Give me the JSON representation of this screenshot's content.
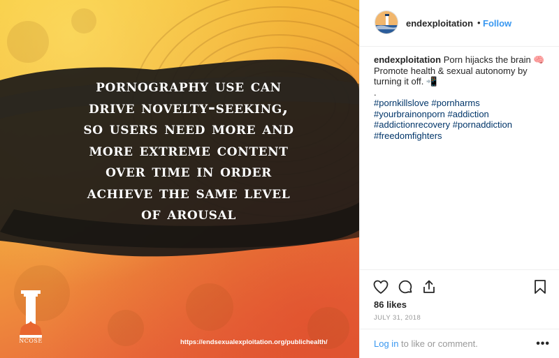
{
  "post": {
    "image": {
      "headline_lines": [
        "Pornography use can",
        "drive novelty-seeking,",
        "so users need more and",
        "more extreme content",
        "over time in order",
        "achieve the same level",
        "of arousal"
      ],
      "logo_text": "NCOSE",
      "url": "https://endsexualexploitation.org/publichealth/"
    },
    "header": {
      "username": "endexploitation",
      "separator": "•",
      "follow_label": "Follow"
    },
    "caption": {
      "username": "endexploitation",
      "text": "Porn hijacks the brain 🧠 Promote health & sexual autonomy by turning it off. 📲",
      "dot": ".",
      "hashtags": [
        "#pornkillslove #pornharms",
        "#yourbrainonporn #addiction",
        "#addictionrecovery #pornaddiction",
        "#freedomfighters"
      ]
    },
    "actions": {
      "like_icon": "heart-icon",
      "comment_icon": "comment-icon",
      "share_icon": "share-icon",
      "save_icon": "bookmark-icon"
    },
    "likes": "86 likes",
    "date": "July 31, 2018",
    "login": {
      "link": "Log in",
      "rest": " to like or comment."
    },
    "more_label": "•••",
    "colors": {
      "link_blue": "#3897f0",
      "hashtag_blue": "#003569",
      "muted": "#999999"
    }
  }
}
